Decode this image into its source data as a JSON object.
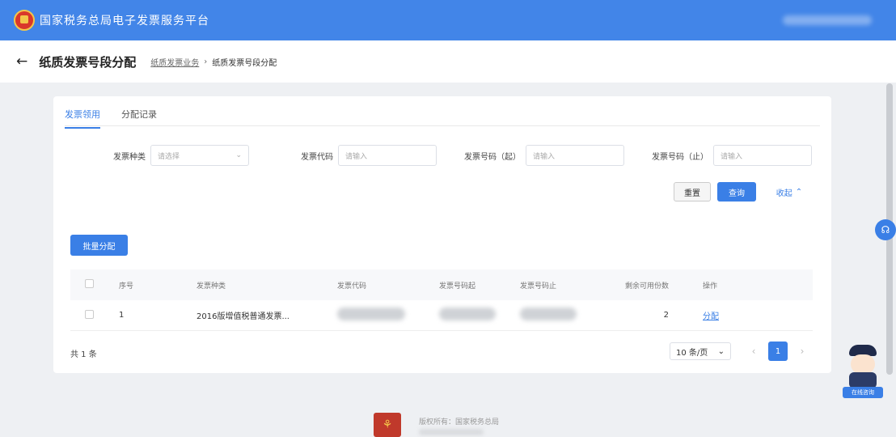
{
  "header": {
    "title": "国家税务总局电子发票服务平台"
  },
  "subheader": {
    "back_icon": "arrow-left-icon",
    "title": "纸质发票号段分配",
    "breadcrumb": {
      "parent": "纸质发票业务",
      "separator": "›",
      "current": "纸质发票号段分配"
    }
  },
  "tabs": [
    {
      "label": "发票领用"
    },
    {
      "label": "分配记录"
    }
  ],
  "filters": {
    "invoice_type": {
      "label": "发票种类",
      "placeholder": "请选择"
    },
    "invoice_code": {
      "label": "发票代码",
      "placeholder": "请输入"
    },
    "number_start": {
      "label": "发票号码（起）",
      "placeholder": "请输入"
    },
    "number_end": {
      "label": "发票号码（止）",
      "placeholder": "请输入"
    }
  },
  "buttons": {
    "reset": "重置",
    "search": "查询",
    "collapse": "收起",
    "batch": "批量分配"
  },
  "table": {
    "columns": [
      "序号",
      "发票种类",
      "发票代码",
      "发票号码起",
      "发票号码止",
      "剩余可用份数",
      "操作"
    ],
    "rows": [
      {
        "index": "1",
        "type": "2016版增值税普通发票...",
        "remaining": "2",
        "action": "分配"
      }
    ]
  },
  "pagination": {
    "total": "共 1 条",
    "page_size": "10 条/页",
    "current_page": "1"
  },
  "assistant": {
    "label": "在线咨询"
  },
  "footer": {
    "copyright": "版权所有：国家税务总局"
  },
  "colors": {
    "primary": "#3a7fe6",
    "header": "#4285e8"
  }
}
